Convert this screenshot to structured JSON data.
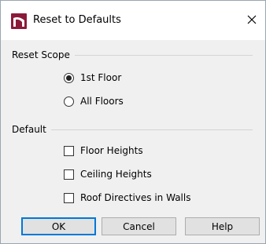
{
  "window": {
    "title": "Reset to Defaults",
    "close_glyph": "✕"
  },
  "reset_scope": {
    "label": "Reset Scope",
    "options": [
      {
        "label": "1st Floor",
        "selected": true
      },
      {
        "label": "All Floors",
        "selected": false
      }
    ]
  },
  "default_group": {
    "label": "Default",
    "options": [
      {
        "label": "Floor Heights",
        "checked": false
      },
      {
        "label": "Ceiling Heights",
        "checked": false
      },
      {
        "label": "Roof Directives in Walls",
        "checked": false
      }
    ]
  },
  "buttons": {
    "ok": "OK",
    "cancel": "Cancel",
    "help": "Help"
  },
  "colors": {
    "app_icon": "#8b1a3a",
    "default_button_border": "#0078d7"
  },
  "icons": {
    "app": "chief-architect-app-icon",
    "close": "close-icon"
  }
}
